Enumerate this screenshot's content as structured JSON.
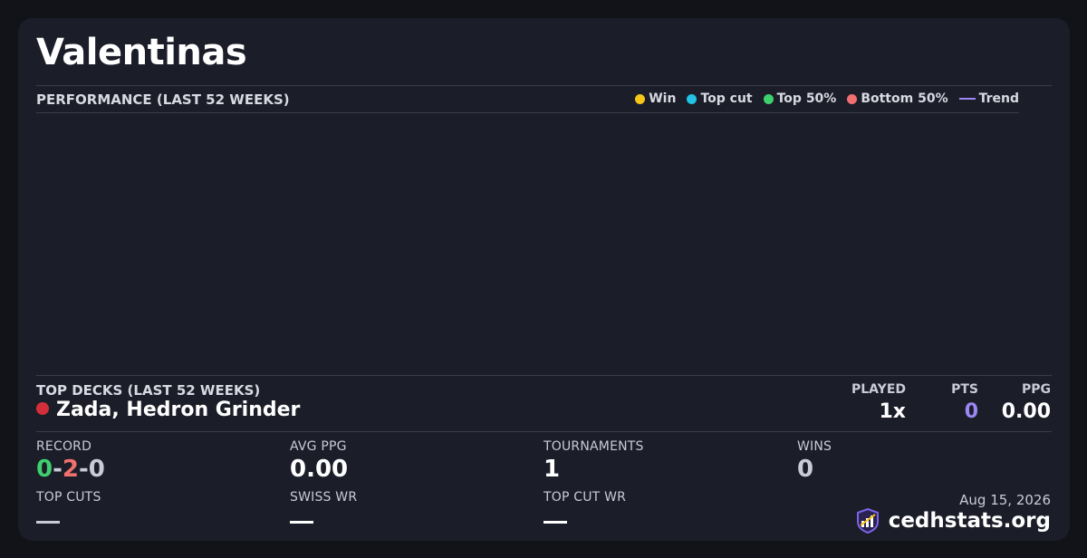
{
  "player": {
    "name": "Valentinas"
  },
  "performance": {
    "label": "PERFORMANCE (LAST 52 WEEKS)",
    "legend": [
      {
        "name": "win",
        "label": "Win",
        "color": "#f5c518",
        "kind": "dot"
      },
      {
        "name": "top-cut",
        "label": "Top cut",
        "color": "#22c3e6",
        "kind": "dot"
      },
      {
        "name": "top-50",
        "label": "Top 50%",
        "color": "#3ecf6e",
        "kind": "dot"
      },
      {
        "name": "bottom-50",
        "label": "Bottom 50%",
        "color": "#f07070",
        "kind": "dot"
      },
      {
        "name": "trend",
        "label": "Trend",
        "color": "#9b87f5",
        "kind": "line"
      }
    ]
  },
  "top_decks": {
    "label": "TOP DECKS (LAST 52 WEEKS)",
    "columns": {
      "played": "PLAYED",
      "pts": "PTS",
      "ppg": "PPG"
    },
    "decks": [
      {
        "name": "Zada, Hedron Grinder",
        "color": "#d32f3a",
        "played": "1x",
        "pts": "0",
        "ppg": "0.00"
      }
    ]
  },
  "stats": {
    "record": {
      "label": "RECORD",
      "wins": "0",
      "sep1": "-",
      "losses": "2",
      "sep2": "-",
      "draws": "0",
      "win_color": "#3ecf6e",
      "loss_color": "#f07070",
      "draw_color": "#c9ccd6"
    },
    "avg_ppg": {
      "label": "AVG PPG",
      "value": "0.00"
    },
    "tournaments": {
      "label": "TOURNAMENTS",
      "value": "1"
    },
    "wins": {
      "label": "WINS",
      "value": "0"
    },
    "top_cuts": {
      "label": "TOP CUTS",
      "value": "—"
    },
    "swiss_wr": {
      "label": "SWISS WR",
      "value": "—"
    },
    "top_cut_wr": {
      "label": "TOP CUT WR",
      "value": "—"
    }
  },
  "footer": {
    "date": "Aug 15, 2026",
    "brand": "cedhstats.org",
    "logo_icon": "bar-chart-shield-icon"
  },
  "colors": {
    "pts_accent": "#9b87f5",
    "muted_value": "#c9ccd6"
  }
}
